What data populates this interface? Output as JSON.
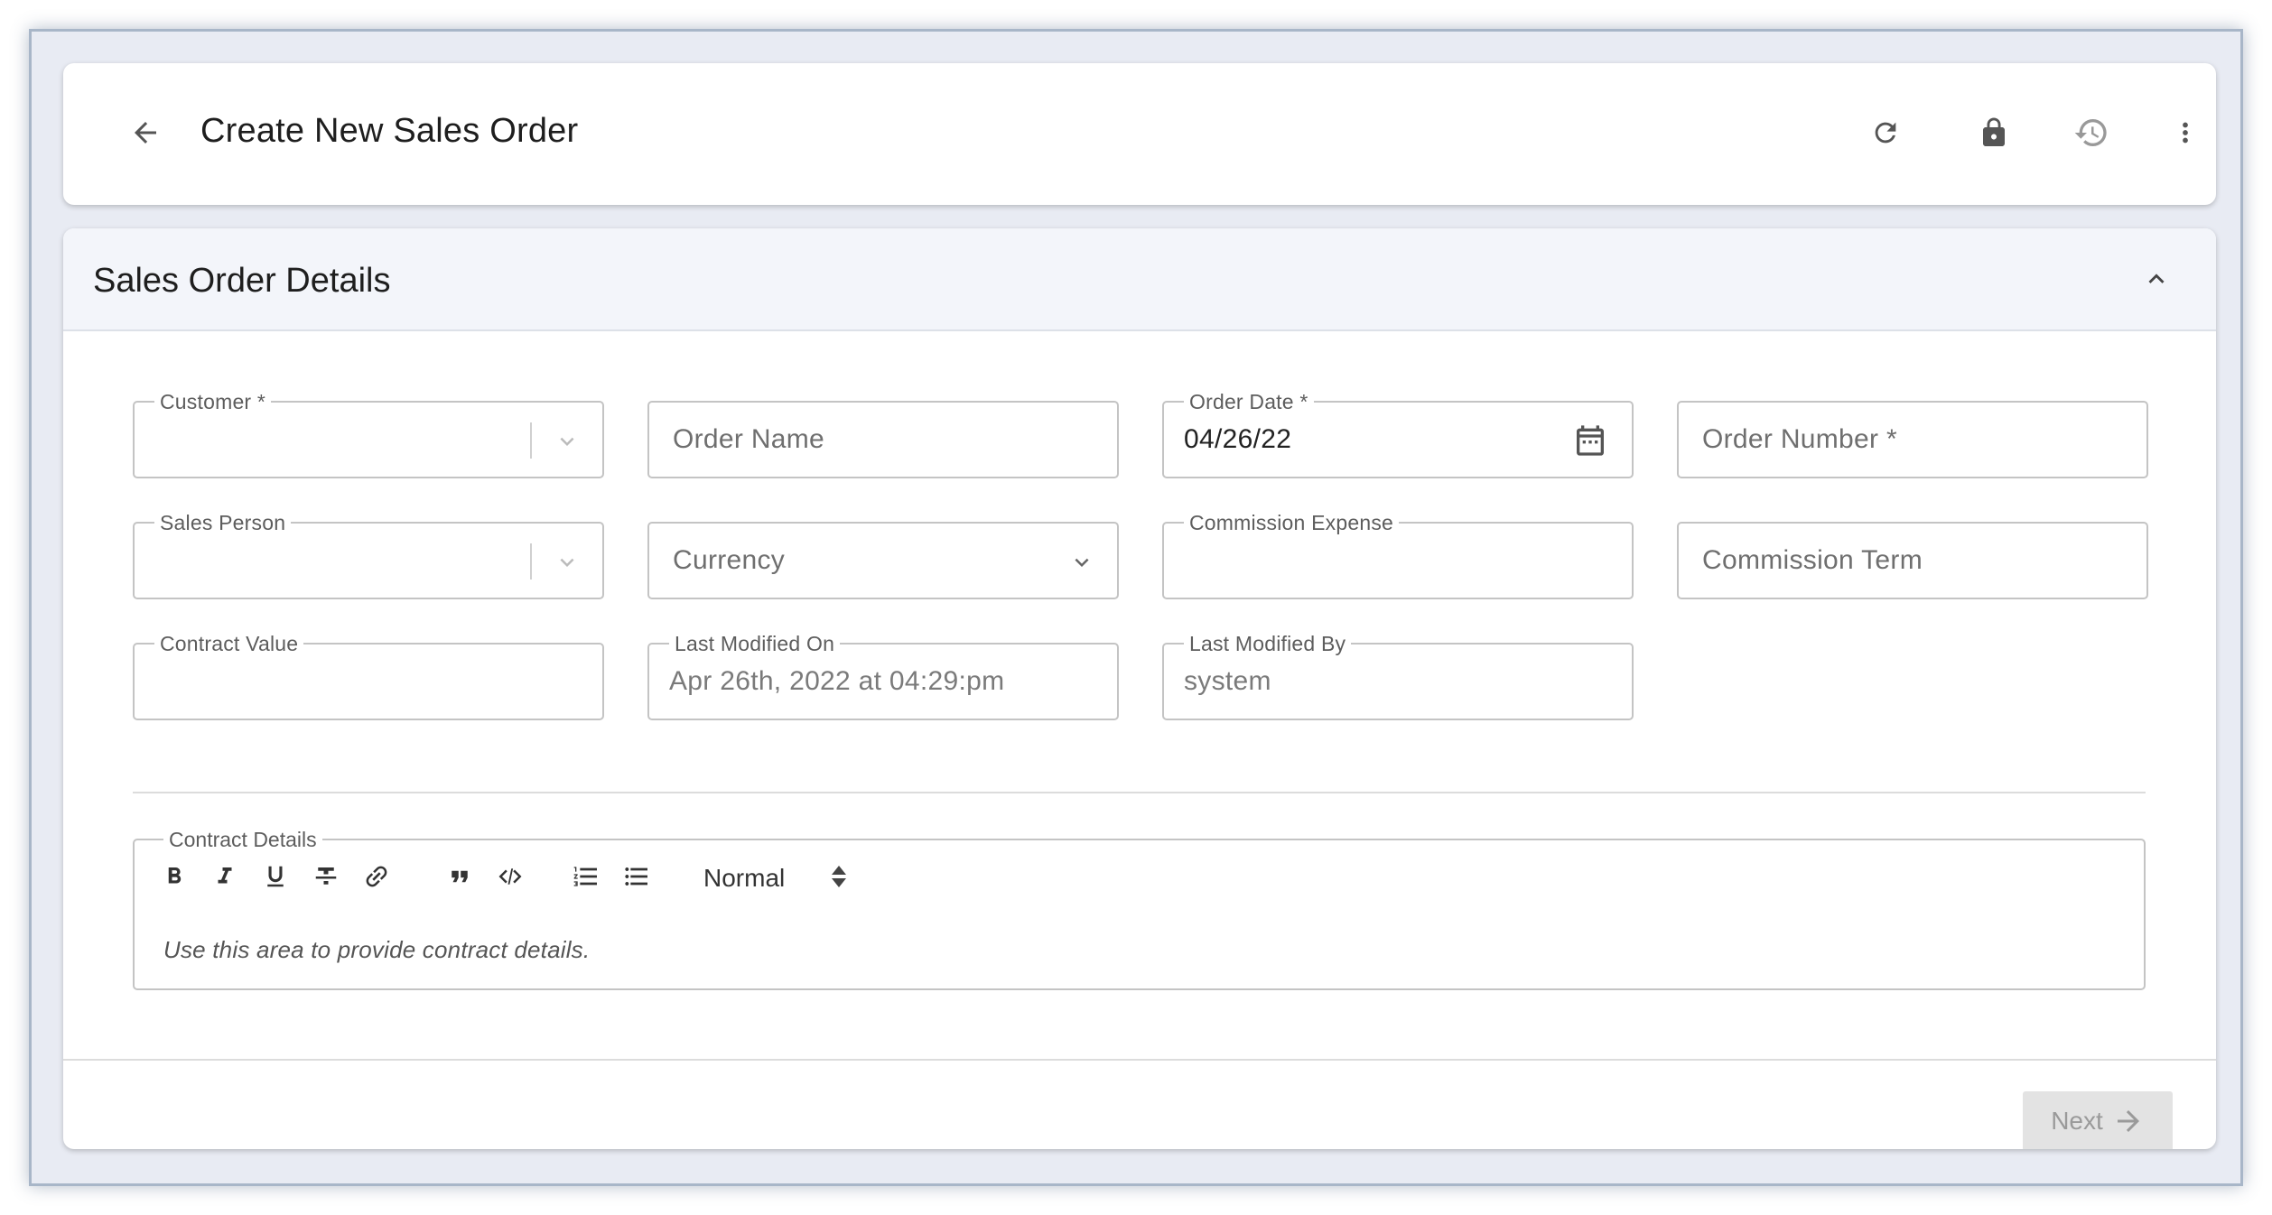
{
  "header": {
    "title": "Create New Sales Order",
    "icons": [
      "back-arrow-icon",
      "refresh-icon",
      "lock-icon",
      "history-icon",
      "more-vert-icon"
    ]
  },
  "section": {
    "title": "Sales Order Details"
  },
  "fields": {
    "customer": {
      "label": "Customer *",
      "value": ""
    },
    "order_name": {
      "placeholder": "Order Name"
    },
    "order_date": {
      "label": "Order Date *",
      "value": "04/26/22"
    },
    "order_number": {
      "placeholder": "Order Number *"
    },
    "sales_person": {
      "label": "Sales Person",
      "value": ""
    },
    "currency": {
      "placeholder": "Currency"
    },
    "commission_expense": {
      "label": "Commission Expense",
      "value": ""
    },
    "commission_term": {
      "placeholder": "Commission Term"
    },
    "contract_value": {
      "label": "Contract Value",
      "value": ""
    },
    "last_modified_on": {
      "label": "Last Modified On",
      "value": "Apr 26th, 2022 at 04:29:pm"
    },
    "last_modified_by": {
      "label": "Last Modified By",
      "value": "system"
    }
  },
  "editor": {
    "label": "Contract Details",
    "format_select": "Normal",
    "placeholder": "Use this area to provide contract details."
  },
  "footer": {
    "next_label": "Next"
  },
  "colors": {
    "frame_bg": "#e8ebf3",
    "frame_border": "#a8b6c8",
    "section_head_bg": "#f3f5fa",
    "disabled_button": "#e3e3e3"
  }
}
